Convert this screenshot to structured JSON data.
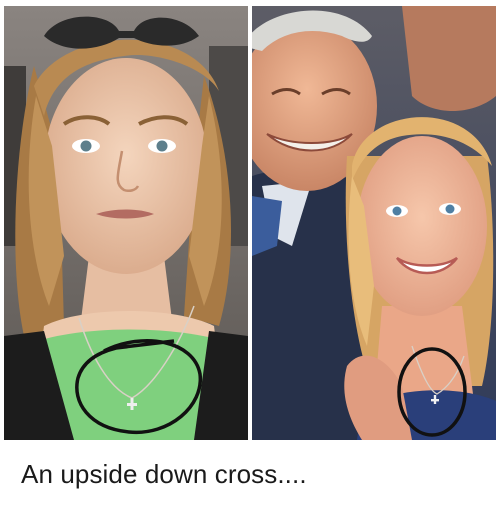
{
  "caption": "An upside down cross....",
  "colors": {
    "left_background": "#6f6a66",
    "left_hair": "#b98a52",
    "left_skin": "#eec9ad",
    "left_top": "#7fd07e",
    "left_cardigan": "#1c1c1c",
    "right_background": "#3d4a6a",
    "right_hair": "#e2b36f",
    "right_skin": "#f0b69a",
    "man_skin": "#e8a985",
    "man_suit": "#27314a",
    "man_hair": "#d8d8d4",
    "tie": "#3b5d9c",
    "annotation_circle": "#111111"
  },
  "icons": [
    "cross-pendant-icon",
    "cross-pendant-icon"
  ]
}
